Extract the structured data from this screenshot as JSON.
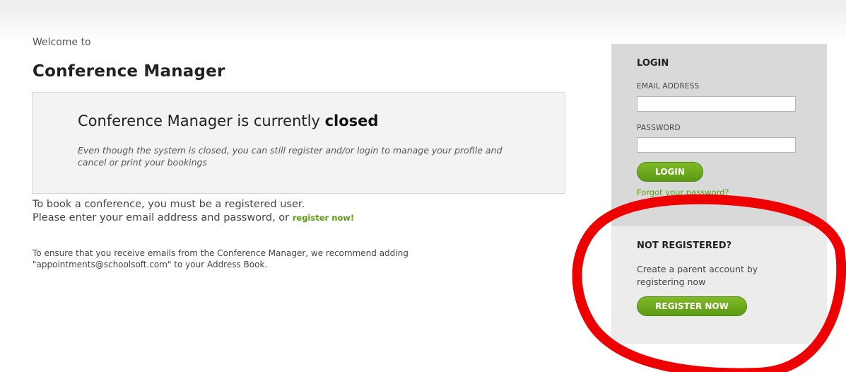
{
  "welcome": {
    "prefix": "Welcome to",
    "app_title": "Conference Manager"
  },
  "notice": {
    "heading_prefix": "Conference Manager is currently",
    "status_word": "closed",
    "note": "Even though the system is closed, you can still register and/or login to manage your profile and cancel or print your bookings"
  },
  "intro": {
    "line1": "To book a conference, you must be a registered user.",
    "line2_prefix": "Please enter your email address and password, or",
    "register_link": "register now!",
    "email_tip": "To ensure that you receive emails from the Conference Manager, we recommend adding \"appointments@schoolsoft.com\" to your Address Book."
  },
  "login": {
    "heading": "LOGIN",
    "email_label": "EMAIL ADDRESS",
    "email_value": "",
    "password_label": "PASSWORD",
    "password_value": "",
    "button_label": "LOGIN",
    "forgot_link": "Forgot your password?"
  },
  "register": {
    "heading": "NOT REGISTERED?",
    "text": "Create a parent account by registering now",
    "button_label": "REGISTER NOW"
  },
  "colors": {
    "accent_green": "#5a9c12",
    "login_panel": "#d9d9d9",
    "register_panel": "#ececec",
    "highlight_ring": "#ee0000"
  }
}
